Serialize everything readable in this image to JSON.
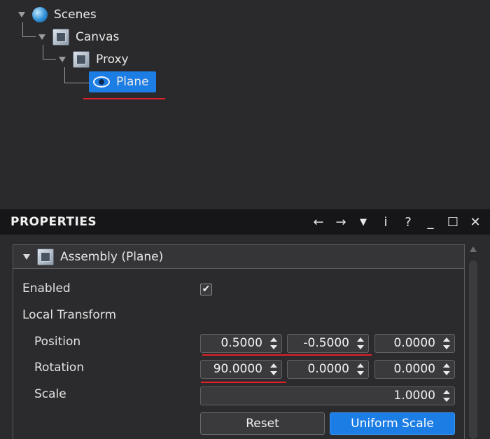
{
  "scene_tree": {
    "nodes": [
      {
        "label": "Scenes",
        "icon": "globe-icon"
      },
      {
        "label": "Canvas",
        "icon": "assembly-icon"
      },
      {
        "label": "Proxy",
        "icon": "assembly-icon"
      },
      {
        "label": "Plane",
        "icon": "eye-icon",
        "selected": true
      }
    ]
  },
  "properties": {
    "title": "PROPERTIES",
    "header_icons": [
      "←",
      "→",
      "▼",
      "i",
      "?",
      "_",
      "☐",
      "✕"
    ],
    "assembly_title": "Assembly (Plane)",
    "enabled_label": "Enabled",
    "enabled_checked": "✔",
    "local_transform_label": "Local Transform",
    "position": {
      "label": "Position",
      "values": [
        "0.5000",
        "-0.5000",
        "0.0000"
      ]
    },
    "rotation": {
      "label": "Rotation",
      "values": [
        "90.0000",
        "0.0000",
        "0.0000"
      ]
    },
    "scale": {
      "label": "Scale",
      "value": "1.0000"
    },
    "reset_label": "Reset",
    "uniform_scale_label": "Uniform Scale"
  },
  "colors": {
    "accent": "#1c7de5",
    "annotation_red": "#e0202a",
    "panel_bg": "#2b2b2d",
    "header_bg": "#161618"
  }
}
